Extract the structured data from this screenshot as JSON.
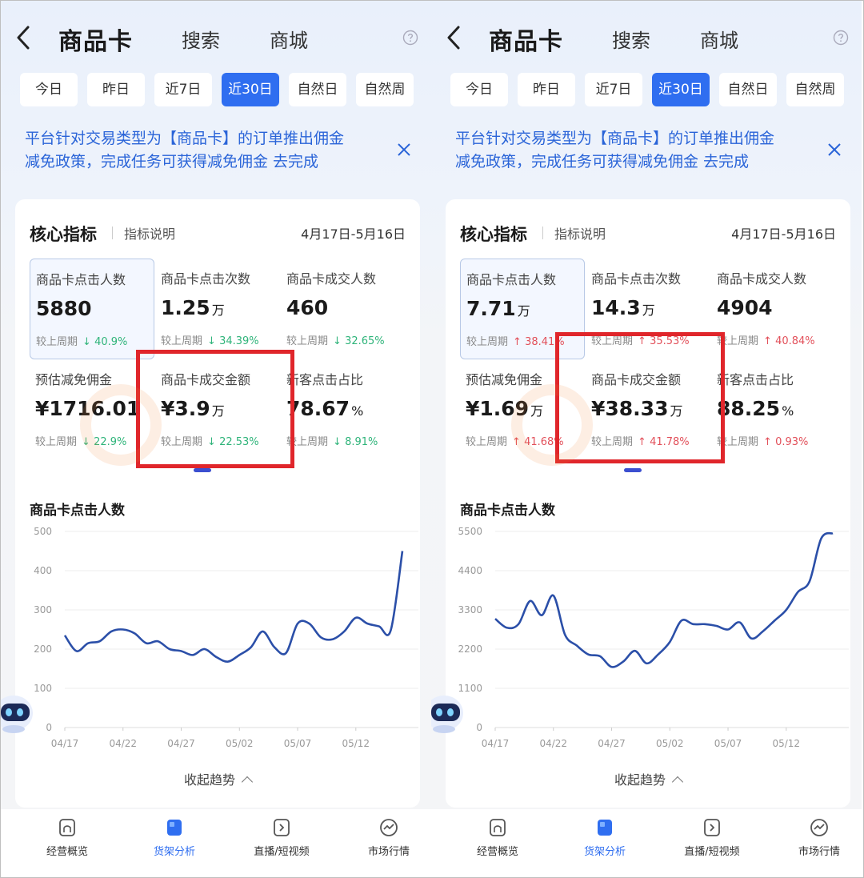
{
  "panels": [
    {
      "header": {
        "title": "商品卡",
        "tabs": [
          "搜索",
          "商城"
        ]
      },
      "chips": [
        {
          "label": "今日",
          "active": false
        },
        {
          "label": "昨日",
          "active": false
        },
        {
          "label": "近7日",
          "active": false
        },
        {
          "label": "近30日",
          "active": true
        },
        {
          "label": "自然日",
          "active": false
        },
        {
          "label": "自然周",
          "active": false
        }
      ],
      "notice": {
        "line1": "平台针对交易类型为【商品卡】的订单推出佣金",
        "line2": "减免政策，完成任务可获得减免佣金 去完成"
      },
      "card": {
        "title": "核心指标",
        "link": "指标说明",
        "date_range": "4月17日-5月16日",
        "compare_label": "较上周期",
        "metrics": [
          {
            "label": "商品卡点击人数",
            "value": "5880",
            "unit": "",
            "change": "40.9%",
            "direction": "down",
            "selected": true
          },
          {
            "label": "商品卡点击次数",
            "value": "1.25",
            "unit": "万",
            "change": "34.39%",
            "direction": "down",
            "selected": false
          },
          {
            "label": "商品卡成交人数",
            "value": "460",
            "unit": "",
            "change": "32.65%",
            "direction": "down",
            "selected": false
          },
          {
            "label": "预估减免佣金",
            "value": "¥1716.01",
            "unit": "",
            "change": "22.9%",
            "direction": "down",
            "selected": false
          },
          {
            "label": "商品卡成交金额",
            "value": "¥3.9",
            "unit": "万",
            "change": "22.53%",
            "direction": "down",
            "selected": false
          },
          {
            "label": "新客点击占比",
            "value": "78.67",
            "unit": "%",
            "change": "8.91%",
            "direction": "down",
            "selected": false
          }
        ],
        "highlight_metric_index": 4,
        "chart_title": "商品卡点击人数",
        "collapse_label": "收起趋势"
      },
      "chart_data": {
        "type": "line",
        "title": "商品卡点击人数",
        "xlabel": "",
        "ylabel": "",
        "ylim": [
          0,
          500
        ],
        "yticks": [
          0,
          100,
          200,
          300,
          400,
          500
        ],
        "xticks": [
          "04/17",
          "04/22",
          "04/27",
          "05/02",
          "05/07",
          "05/12"
        ],
        "x": [
          "04/17",
          "04/18",
          "04/19",
          "04/20",
          "04/21",
          "04/22",
          "04/23",
          "04/24",
          "04/25",
          "04/26",
          "04/27",
          "04/28",
          "04/29",
          "04/30",
          "05/01",
          "05/02",
          "05/03",
          "05/04",
          "05/05",
          "05/06",
          "05/07",
          "05/08",
          "05/09",
          "05/10",
          "05/11",
          "05/12",
          "05/13",
          "05/14",
          "05/15",
          "05/16"
        ],
        "series": [
          {
            "values": [
              235,
              195,
              215,
              220,
              245,
              250,
              240,
              215,
              220,
              200,
              195,
              185,
              200,
              180,
              168,
              185,
              205,
              245,
              205,
              190,
              265,
              265,
              230,
              225,
              245,
              280,
              265,
              258,
              248,
              450
            ]
          }
        ],
        "line_color": "#2b4fa8"
      },
      "nav": [
        {
          "label": "经营概览",
          "icon": "home-icon",
          "active": false
        },
        {
          "label": "货架分析",
          "icon": "shelf-icon",
          "active": true
        },
        {
          "label": "直播/短视频",
          "icon": "play-icon",
          "active": false
        },
        {
          "label": "市场行情",
          "icon": "trend-icon",
          "active": false
        }
      ]
    },
    {
      "header": {
        "title": "商品卡",
        "tabs": [
          "搜索",
          "商城"
        ]
      },
      "chips": [
        {
          "label": "今日",
          "active": false
        },
        {
          "label": "昨日",
          "active": false
        },
        {
          "label": "近7日",
          "active": false
        },
        {
          "label": "近30日",
          "active": true
        },
        {
          "label": "自然日",
          "active": false
        },
        {
          "label": "自然周",
          "active": false
        }
      ],
      "notice": {
        "line1": "平台针对交易类型为【商品卡】的订单推出佣金",
        "line2": "减免政策，完成任务可获得减免佣金 去完成"
      },
      "card": {
        "title": "核心指标",
        "link": "指标说明",
        "date_range": "4月17日-5月16日",
        "compare_label": "较上周期",
        "metrics": [
          {
            "label": "商品卡点击人数",
            "value": "7.71",
            "unit": "万",
            "change": "38.41%",
            "direction": "up",
            "selected": true
          },
          {
            "label": "商品卡点击次数",
            "value": "14.3",
            "unit": "万",
            "change": "35.53%",
            "direction": "up",
            "selected": false
          },
          {
            "label": "商品卡成交人数",
            "value": "4904",
            "unit": "",
            "change": "40.84%",
            "direction": "up",
            "selected": false
          },
          {
            "label": "预估减免佣金",
            "value": "¥1.69",
            "unit": "万",
            "change": "41.68%",
            "direction": "up",
            "selected": false
          },
          {
            "label": "商品卡成交金额",
            "value": "¥38.33",
            "unit": "万",
            "change": "41.78%",
            "direction": "up",
            "selected": false
          },
          {
            "label": "新客点击占比",
            "value": "88.25",
            "unit": "%",
            "change": "0.93%",
            "direction": "up",
            "selected": false
          }
        ],
        "highlight_metric_index": 4,
        "chart_title": "商品卡点击人数",
        "collapse_label": "收起趋势"
      },
      "chart_data": {
        "type": "line",
        "title": "商品卡点击人数",
        "xlabel": "",
        "ylabel": "",
        "ylim": [
          0,
          5500
        ],
        "yticks": [
          0,
          1100,
          2200,
          3300,
          4400,
          5500
        ],
        "xticks": [
          "04/17",
          "04/22",
          "04/27",
          "05/02",
          "05/07",
          "05/12"
        ],
        "x": [
          "04/17",
          "04/18",
          "04/19",
          "04/20",
          "04/21",
          "04/22",
          "04/23",
          "04/24",
          "04/25",
          "04/26",
          "04/27",
          "04/28",
          "04/29",
          "04/30",
          "05/01",
          "05/02",
          "05/03",
          "05/04",
          "05/05",
          "05/06",
          "05/07",
          "05/08",
          "05/09",
          "05/10",
          "05/11",
          "05/12",
          "05/13",
          "05/14",
          "05/15",
          "05/16"
        ],
        "series": [
          {
            "values": [
              3050,
              2800,
              2900,
              3550,
              3150,
              3700,
              2600,
              2300,
              2050,
              2000,
              1700,
              1850,
              2150,
              1800,
              2050,
              2400,
              3000,
              2900,
              2900,
              2850,
              2750,
              2950,
              2500,
              2700,
              3000,
              3300,
              3800,
              4100,
              5300,
              5450
            ]
          }
        ],
        "line_color": "#2b4fa8"
      },
      "nav": [
        {
          "label": "经营概览",
          "icon": "home-icon",
          "active": false
        },
        {
          "label": "货架分析",
          "icon": "shelf-icon",
          "active": true
        },
        {
          "label": "直播/短视频",
          "icon": "play-icon",
          "active": false
        },
        {
          "label": "市场行情",
          "icon": "trend-icon",
          "active": false
        }
      ]
    }
  ]
}
